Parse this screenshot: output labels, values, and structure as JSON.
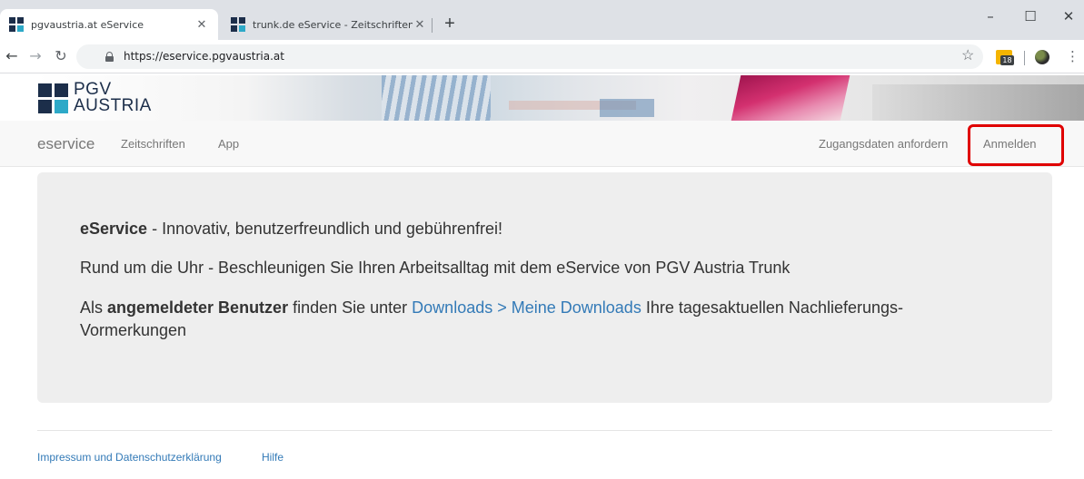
{
  "browser": {
    "tabs": [
      {
        "title": "pgvaustria.at eService",
        "active": true
      },
      {
        "title": "trunk.de eService - Zeitschriften",
        "active": false
      }
    ],
    "new_tab_icon": "+",
    "window_controls": {
      "minimize": "–",
      "maximize": "☐",
      "close": "✕"
    },
    "url": "https://eservice.pgvaustria.at",
    "calendar_badge": "18"
  },
  "site": {
    "logo": {
      "line1": "PGV",
      "line2": "AUSTRIA"
    },
    "navbar": {
      "brand": "eservice",
      "left_links": [
        "Zeitschriften",
        "App"
      ],
      "right_links": [
        "Zugangsdaten anfordern",
        "Anmelden"
      ]
    },
    "jumbotron": {
      "p1_bold": "eService",
      "p1_rest": " - Innovativ, benutzerfreundlich und gebührenfrei!",
      "p2": "Rund um die Uhr - Beschleunigen Sie Ihren Arbeitsalltag mit dem eService von PGV Austria Trunk",
      "p3_pre": "Als ",
      "p3_bold": "angemeldeter Benutzer",
      "p3_mid": " finden Sie unter ",
      "p3_link": "Downloads > Meine Downloads",
      "p3_post": " Ihre tagesaktuellen Nachlieferungs-Vormerkungen"
    },
    "footer": {
      "links": [
        "Impressum und Datenschutzerklärung",
        "Hilfe"
      ]
    }
  },
  "colors": {
    "link": "#337ab7",
    "highlight": "#e00000",
    "logo_dark": "#1c2e4a",
    "logo_accent": "#2da9c8"
  }
}
